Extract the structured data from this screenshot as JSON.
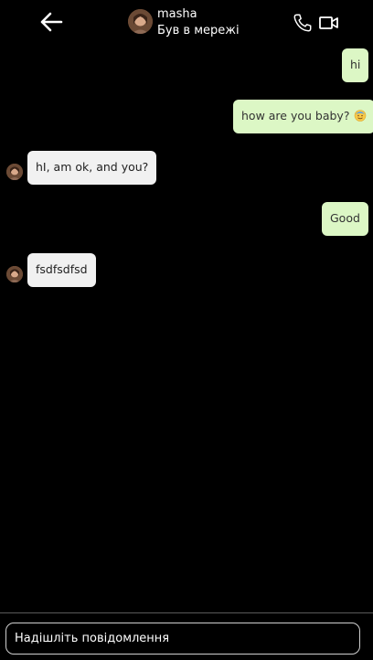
{
  "header": {
    "contact_name": "masha",
    "contact_status": "Був в мережі",
    "back_icon": "arrow-left-icon",
    "call_icon": "phone-icon",
    "video_icon": "video-camera-icon"
  },
  "messages": [
    {
      "direction": "out",
      "text": "hi"
    },
    {
      "direction": "out",
      "text": "how are you baby?",
      "emoji": "smiling-face-emoji"
    },
    {
      "direction": "in",
      "text": "hI, am ok, and you?"
    },
    {
      "direction": "out",
      "text": "Good"
    },
    {
      "direction": "in",
      "text": "fsdfsdfsd"
    }
  ],
  "composer": {
    "placeholder": "Надішліть повідомлення"
  },
  "colors": {
    "background": "#000000",
    "outgoing_bubble": "#dcf7c5",
    "incoming_bubble": "#f1f1f1",
    "divider": "#5a5a5a"
  }
}
